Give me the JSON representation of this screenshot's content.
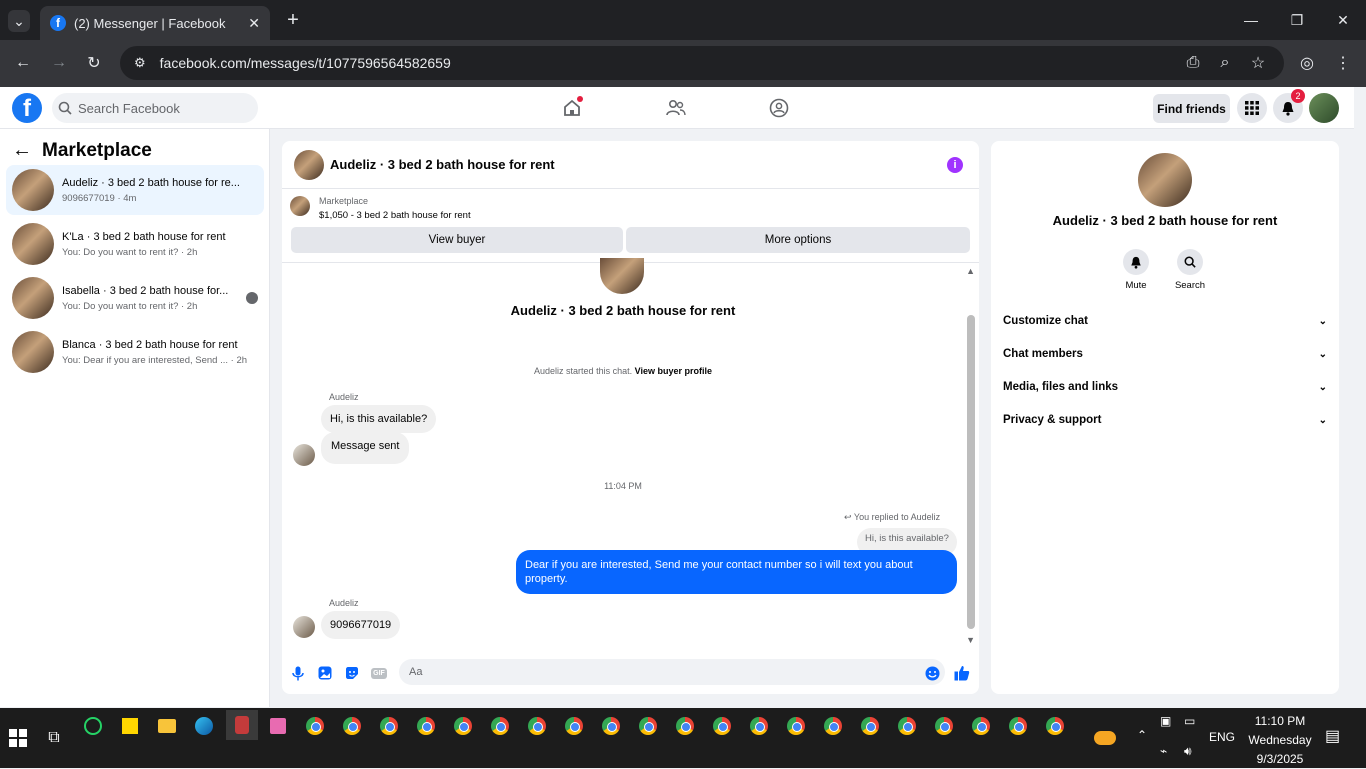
{
  "browser": {
    "tab_title": "(2) Messenger | Facebook",
    "url": "facebook.com/messages/t/1077596564582659"
  },
  "fb_header": {
    "search_placeholder": "Search Facebook",
    "find_friends": "Find friends",
    "notification_count": "2"
  },
  "left_panel": {
    "title": "Marketplace",
    "conversations": [
      {
        "name": "Audeliz · 3 bed 2 bath house for re...",
        "sub": "9096677019 · 4m",
        "active": true
      },
      {
        "name": "K'La · 3 bed 2 bath house for rent",
        "sub": "You: Do you want to rent it? · 2h"
      },
      {
        "name": "Isabella · 3 bed 2 bath house for...",
        "sub": "You: Do you want to rent it? · 2h"
      },
      {
        "name": "Blanca · 3 bed 2 bath house for rent",
        "sub": "You: Dear if you are interested, Send ...  · 2h"
      }
    ]
  },
  "chat": {
    "header_name": "Audeliz · 3 bed 2 bath house for rent",
    "marketplace_label": "Marketplace",
    "listing": "$1,050 - 3 bed 2 bath house for rent",
    "view_buyer": "View buyer",
    "more_options": "More options",
    "intro_name": "Audeliz · 3 bed 2 bath house for rent",
    "started_text": "Audeliz started this chat.",
    "view_buyer_profile": "View buyer profile",
    "sender1": "Audeliz",
    "msg1": "Hi, is this available?",
    "msg2": "Message sent",
    "timestamp": "11:04 PM",
    "replied_to": "You replied to Audeliz",
    "quoted": "Hi, is this available?",
    "outgoing": "Dear if you are interested, Send me your contact number so i will text you about property.",
    "sender2": "Audeliz",
    "msg3": "9096677019",
    "input_placeholder": "Aa"
  },
  "right_panel": {
    "name": "Audeliz · 3 bed 2 bath house for rent",
    "mute": "Mute",
    "search": "Search",
    "sections": [
      "Customize chat",
      "Chat members",
      "Media, files and links",
      "Privacy & support"
    ]
  },
  "taskbar": {
    "lang": "ENG",
    "time": "11:10 PM",
    "day": "Wednesday",
    "date": "9/3/2025"
  },
  "colors": {
    "brand": "#1877f2",
    "outgoing": "#0866ff",
    "info": "#a033ff"
  }
}
